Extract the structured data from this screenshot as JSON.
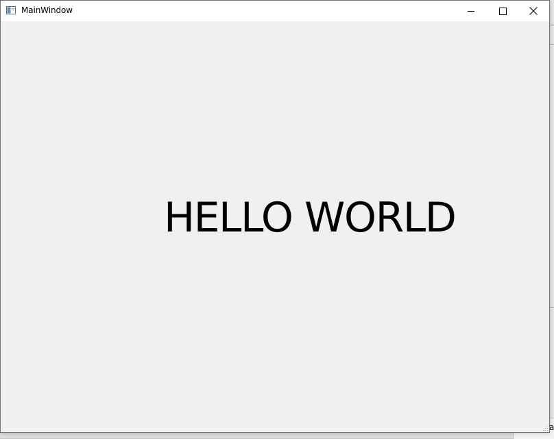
{
  "window": {
    "title": "MainWindow",
    "controls": {
      "minimize_icon": "minimize-icon",
      "maximize_icon": "maximize-icon",
      "close_icon": "close-icon"
    }
  },
  "content": {
    "label": "HELLO WORLD"
  },
  "background": {
    "corner_char": "a"
  },
  "colors": {
    "window_bg": "#f0f0f0",
    "titlebar_bg": "#ffffff",
    "text": "#000000"
  }
}
